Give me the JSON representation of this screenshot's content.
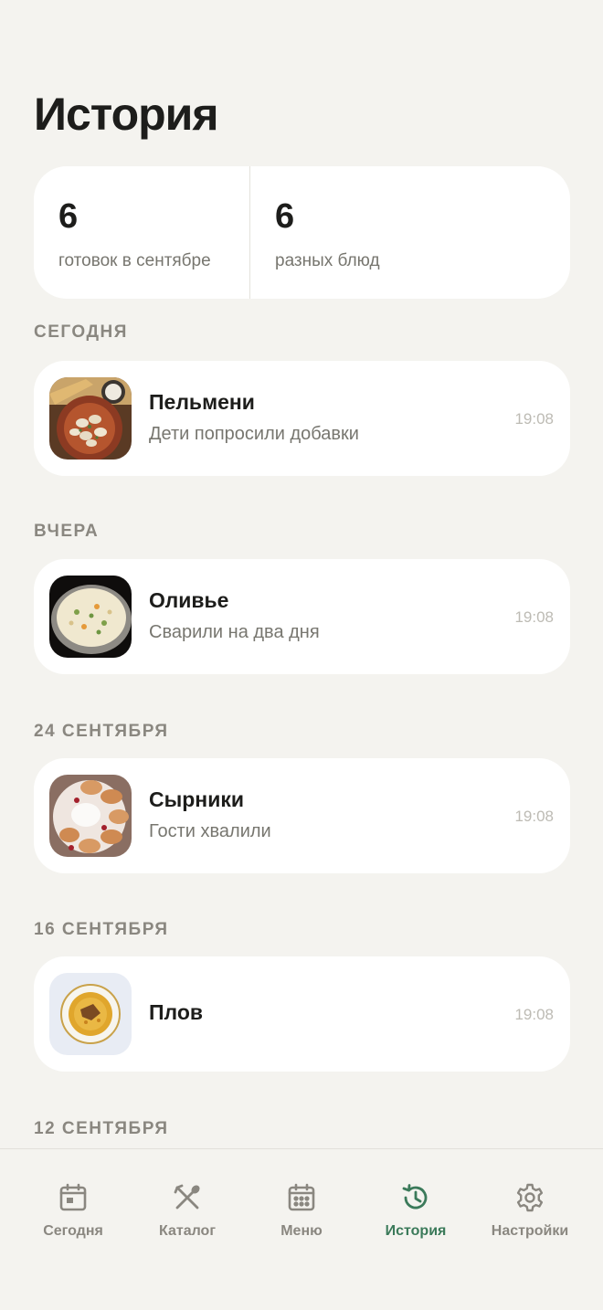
{
  "header": {
    "title": "История"
  },
  "stats": [
    {
      "value": "6",
      "label": "готовок в сентябре"
    },
    {
      "value": "6",
      "label": "разных блюд"
    }
  ],
  "sections": [
    {
      "title": "СЕГОДНЯ",
      "entries": [
        {
          "name": "Пельмени",
          "note": "Дети попросили добавки",
          "time": "19:08",
          "image": "dumplings-photo"
        }
      ]
    },
    {
      "title": "ВЧЕРА",
      "entries": [
        {
          "name": "Оливье",
          "note": "Сварили на два дня",
          "time": "19:08",
          "image": "olivier-salad-photo"
        }
      ]
    },
    {
      "title": "24 СЕНТЯБРЯ",
      "entries": [
        {
          "name": "Сырники",
          "note": "Гости хвалили",
          "time": "19:08",
          "image": "syrniki-photo"
        }
      ]
    },
    {
      "title": "16 СЕНТЯБРЯ",
      "entries": [
        {
          "name": "Плов",
          "note": "",
          "time": "19:08",
          "image": "plov-photo"
        }
      ]
    },
    {
      "title": "12 СЕНТЯБРЯ",
      "entries": []
    }
  ],
  "nav": {
    "active": "history",
    "items": [
      {
        "id": "today",
        "label": "Сегодня",
        "icon": "calendar-day-icon"
      },
      {
        "id": "catalog",
        "label": "Каталог",
        "icon": "fork-spoon-icon"
      },
      {
        "id": "menu",
        "label": "Меню",
        "icon": "calendar-grid-icon"
      },
      {
        "id": "history",
        "label": "История",
        "icon": "history-clock-icon"
      },
      {
        "id": "settings",
        "label": "Настройки",
        "icon": "gear-icon"
      }
    ]
  },
  "colors": {
    "background": "#f4f3ef",
    "card": "#ffffff",
    "accent": "#3b7a5a",
    "muted": "#8a8780"
  }
}
